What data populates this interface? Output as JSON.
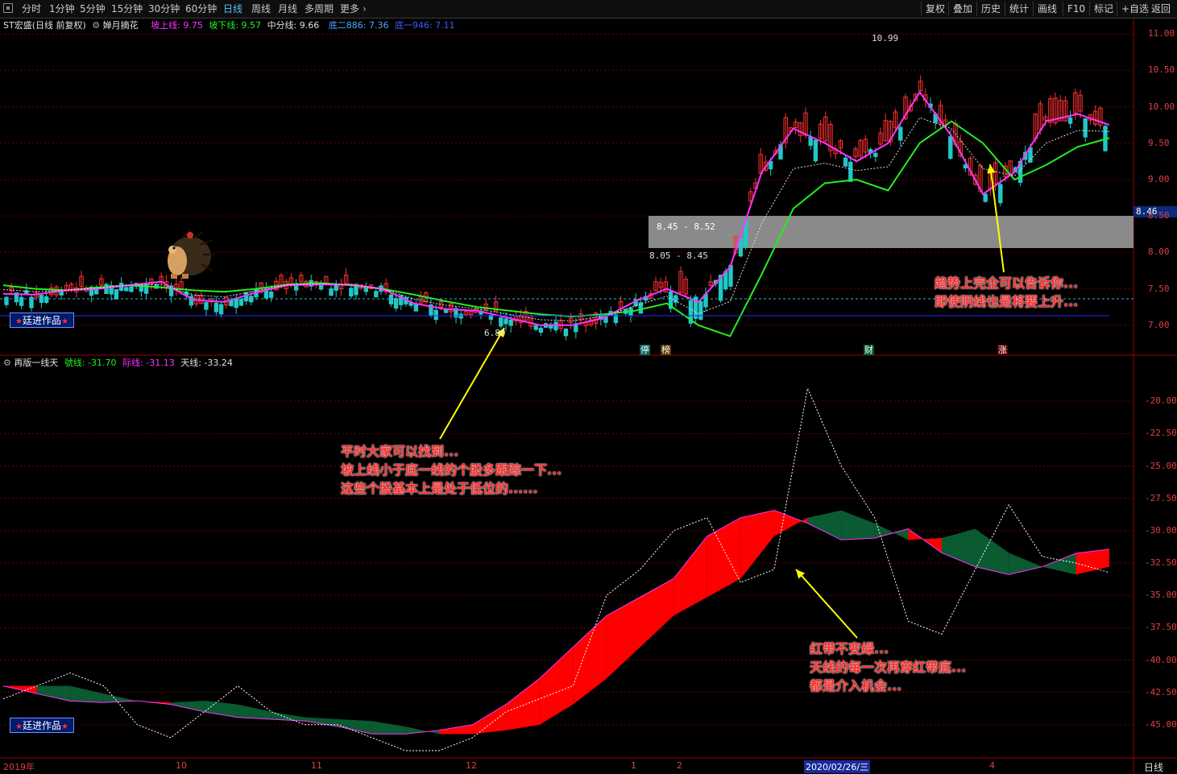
{
  "toolbar": {
    "periods": [
      "分时",
      "1分钟",
      "5分钟",
      "15分钟",
      "30分钟",
      "60分钟",
      "日线",
      "周线",
      "月线",
      "多周期",
      "更多"
    ],
    "active_period": "日线",
    "tools": [
      "复权",
      "叠加",
      "历史",
      "统计",
      "画线",
      "F10",
      "标记",
      "+自选",
      "返回"
    ]
  },
  "main_legend": {
    "stock": "ST宏盛(日线 前复权)",
    "indicator": "婵月摘花",
    "up_line": "坡上线: 9.75",
    "down_line": "坡下线: 9.57",
    "mid_line": "中分线: 9.66",
    "bottom2": "底二886: 7.36",
    "bottom1": "底一946: 7.11"
  },
  "price_axis": [
    "11.00",
    "10.50",
    "10.00",
    "9.50",
    "9.00",
    "8.50",
    "8.00",
    "7.50",
    "7.00"
  ],
  "price_marker": "8.46",
  "chart_labels": {
    "high": "10.99",
    "low": "6.80",
    "gap_upper": "8.45 - 8.52",
    "gap_lower": "8.05 - 8.45"
  },
  "event_tags": [
    "停",
    "榜",
    "财",
    "涨"
  ],
  "sub_legend": {
    "indicator": "再版一线天",
    "hao": "號线: -31.70",
    "ji": "际线: -31.13",
    "tian": "天线: -33.24"
  },
  "sub_axis": [
    "-20.00",
    "-22.50",
    "-25.00",
    "-27.50",
    "-30.00",
    "-32.50",
    "-35.00",
    "-37.50",
    "-40.00",
    "-42.50",
    "-45.00"
  ],
  "dates": [
    "2019年",
    "10",
    "11",
    "12",
    "1",
    "2",
    "2020/02/26/三",
    "4"
  ],
  "period_label": "日线",
  "badge": "廷进作品",
  "annotations": {
    "a1": [
      "趋势上完全可以告诉你...",
      "即使阴线也是将要上升..."
    ],
    "a2": [
      "平时大家可以找到...",
      "坡上线小于底一线的个股多跟踪一下...",
      "这些个股基本上是处于低位的......"
    ],
    "a3": [
      "红带不变绿...",
      "天线的每一次再穿红带底...",
      "都是介入机会..."
    ]
  },
  "colors": {
    "magenta": "#ff33ff",
    "green": "#22ee22",
    "up": "#ff3030",
    "down": "#20c8c8",
    "bg": "#000000",
    "grid": "#6b0000",
    "ribbon_red": "#ff0000",
    "ribbon_green": "#0a5a32"
  },
  "chart_data": {
    "type": "line",
    "main_ylim": [
      6.6,
      11.2
    ],
    "sub_ylim": [
      -47.5,
      -16.5
    ],
    "series": [
      {
        "name": "坡上线",
        "values": [
          7.43,
          7.42,
          7.48,
          7.5,
          7.55,
          7.6,
          7.35,
          7.32,
          7.45,
          7.55,
          7.56,
          7.56,
          7.5,
          7.3,
          7.22,
          7.2,
          7.1,
          7.0,
          7.0,
          7.1,
          7.33,
          7.5,
          7.32,
          7.8,
          9.1,
          9.7,
          9.5,
          9.25,
          9.5,
          10.2,
          9.6,
          8.8,
          9.1,
          9.8,
          9.9,
          9.75
        ]
      },
      {
        "name": "坡下线",
        "values": [
          7.55,
          7.5,
          7.48,
          7.52,
          7.55,
          7.52,
          7.48,
          7.46,
          7.5,
          7.56,
          7.58,
          7.55,
          7.5,
          7.42,
          7.33,
          7.25,
          7.2,
          7.15,
          7.12,
          7.15,
          7.2,
          7.3,
          7.0,
          6.85,
          7.7,
          8.6,
          8.95,
          9.0,
          8.85,
          9.5,
          9.8,
          9.5,
          9.0,
          9.2,
          9.45,
          9.57
        ]
      },
      {
        "name": "天线",
        "values": [
          -43,
          -42,
          -41,
          -42,
          -45,
          -46,
          -44,
          -42,
          -44,
          -45,
          -45,
          -46,
          -47,
          -47,
          -46,
          -44,
          -43,
          -42,
          -35,
          -33,
          -30,
          -29,
          -34,
          -33,
          -19,
          -25,
          -29,
          -37,
          -38,
          -33,
          -28,
          -32,
          -32.5,
          -33.24
        ]
      }
    ]
  }
}
